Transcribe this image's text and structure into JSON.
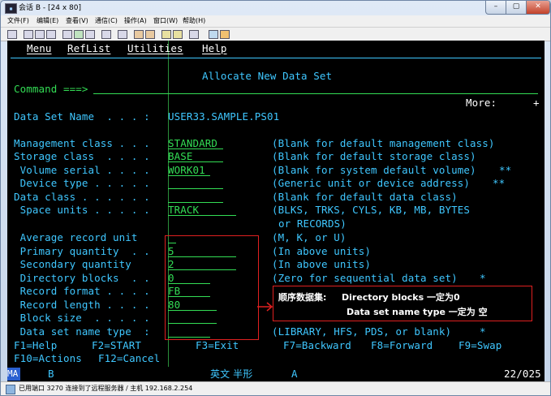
{
  "window": {
    "title": "会话 B - [24 x 80]",
    "controls": {
      "minimize": "–",
      "maximize": "▢",
      "close": "✕"
    }
  },
  "menubar": [
    "文件(F)",
    "编辑(E)",
    "查看(V)",
    "通信(C)",
    "操作(A)",
    "窗口(W)",
    "帮助(H)"
  ],
  "terminal": {
    "actionbar": [
      "Menu",
      "RefList",
      "Utilities",
      "Help"
    ],
    "panel_title": "Allocate New Data Set",
    "command_label": "Command ===>",
    "more_label": "More:",
    "more_indicator": "+",
    "dsname": {
      "label": "Data Set Name  . . . :",
      "value": "USER33.SAMPLE.PS01"
    },
    "fields": [
      {
        "label": "Management class . . .",
        "value": "STANDARD",
        "desc": "(Blank for default management class)",
        "marker": ""
      },
      {
        "label": "Storage class  . . . .",
        "value": "BASE",
        "desc": "(Blank for default storage class)",
        "marker": ""
      },
      {
        "label": " Volume serial . . . .",
        "value": "WORK01",
        "desc": "(Blank for system default volume)",
        "marker": "**"
      },
      {
        "label": " Device type . . . . .",
        "value": "",
        "desc": "(Generic unit or device address)",
        "marker": "**"
      },
      {
        "label": "Data class . . . . . .",
        "value": "",
        "desc": "(Blank for default data class)",
        "marker": ""
      },
      {
        "label": " Space units . . . . .",
        "value": "TRACK",
        "desc": "(BLKS, TRKS, CYLS, KB, MB, BYTES",
        "marker": ""
      }
    ],
    "space_units_cont": "or RECORDS)",
    "fields2": [
      {
        "label": " Average record unit",
        "value": "",
        "desc": "(M, K, or U)",
        "marker": ""
      },
      {
        "label": " Primary quantity  . .",
        "value": "5",
        "desc": "(In above units)",
        "marker": ""
      },
      {
        "label": " Secondary quantity",
        "value": "2",
        "desc": "(In above units)",
        "marker": ""
      },
      {
        "label": " Directory blocks  . .",
        "value": "0",
        "desc": "(Zero for sequential data set)",
        "marker": "*"
      },
      {
        "label": " Record format . . . .",
        "value": "FB",
        "desc": "",
        "marker": ""
      },
      {
        "label": " Record length . . . .",
        "value": "80",
        "desc": "",
        "marker": ""
      },
      {
        "label": " Block size  . . . . .",
        "value": "",
        "desc": "",
        "marker": ""
      },
      {
        "label": " Data set name type  :",
        "value": "",
        "desc": "(LIBRARY, HFS, PDS, or blank)",
        "marker": "*"
      }
    ],
    "pfkeys_row1": [
      "F1=Help",
      "F2=START",
      "F3=Exit",
      "F7=Backward",
      "F8=Forward",
      "F9=Swap"
    ],
    "pfkeys_row2": [
      "F10=Actions",
      "F12=Cancel"
    ]
  },
  "annotation": {
    "line1_bold_cn": "顺序数据集:",
    "line1_rest": "Directory blocks 一定为0",
    "line2": "Data set name type 一定为 空"
  },
  "oia": {
    "mode": "MA",
    "session": "B",
    "ime": "英文 半形",
    "input_mode": "A",
    "cursor": "22/025"
  },
  "statusbar": {
    "text": "已用端口 3270 连接到了远程服务器 / 主机 192.168.2.254"
  },
  "colors": {
    "terminal_bg": "#000000",
    "field_text": "#3fc7ff",
    "input_text": "#33dd55",
    "highlight": "#ffffff",
    "annotation_border": "#e02020"
  }
}
